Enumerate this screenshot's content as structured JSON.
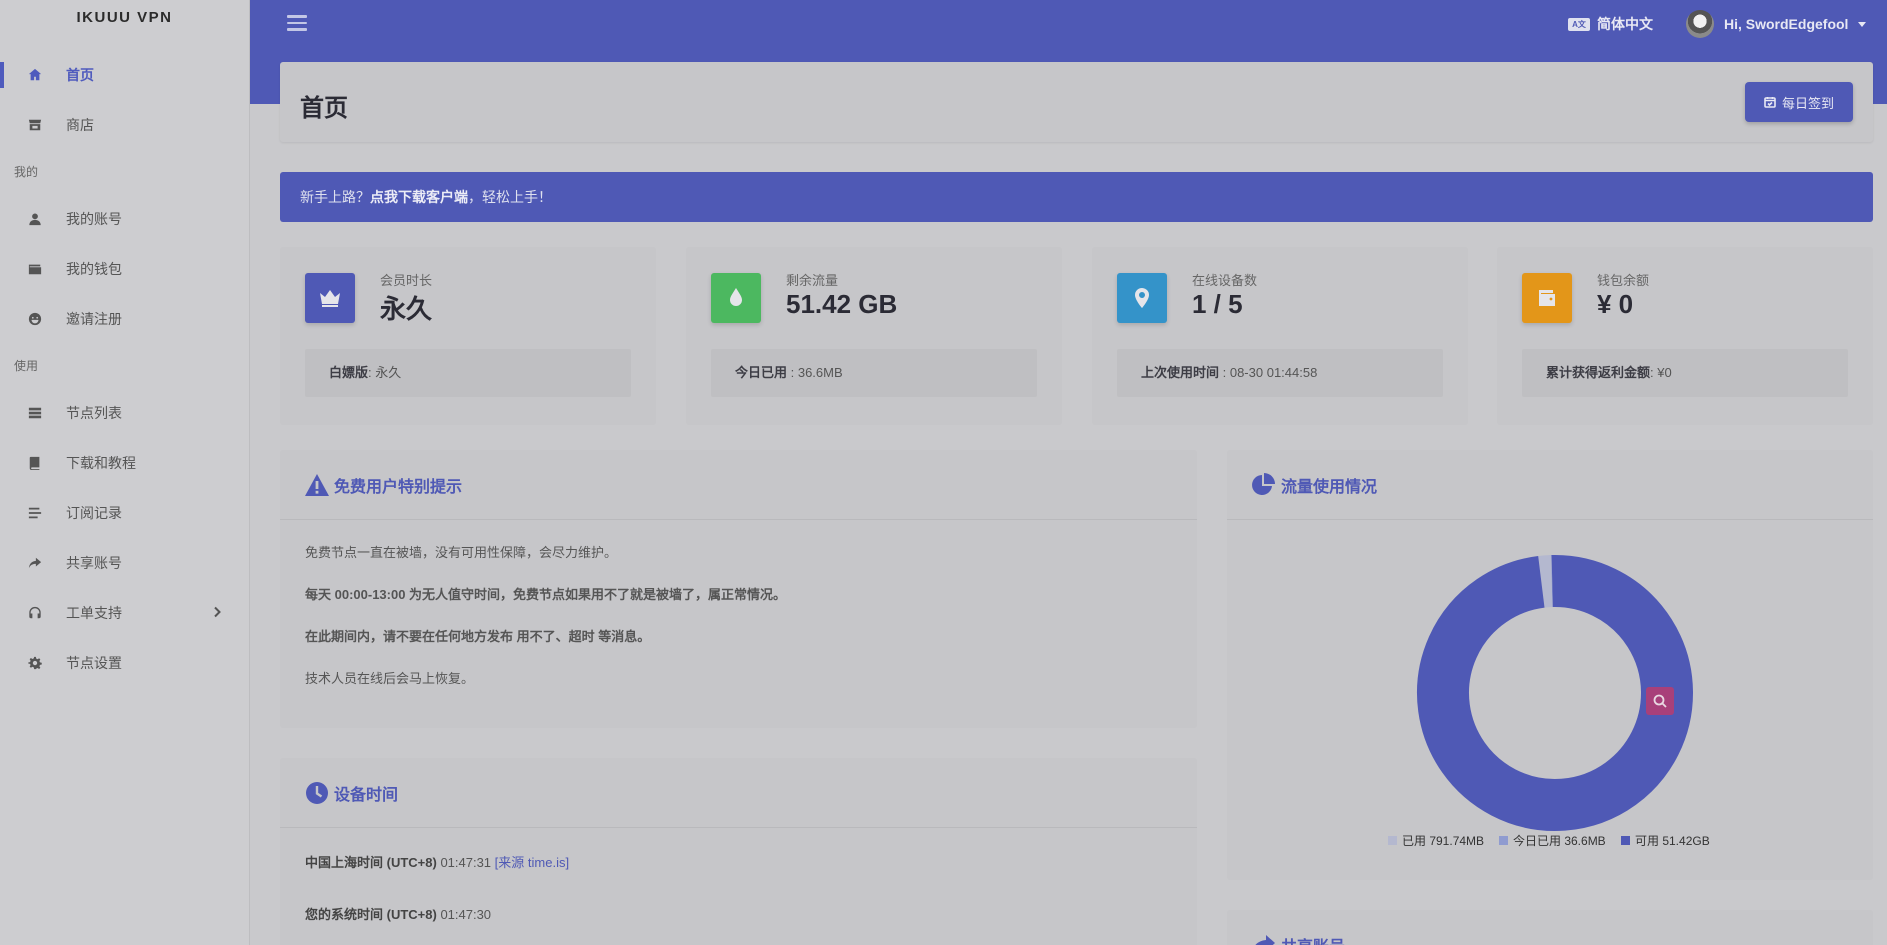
{
  "brand": "IKUUU VPN",
  "sidebar": {
    "items_top": [
      {
        "label": "首页",
        "icon": "home-icon",
        "active": true
      },
      {
        "label": "商店",
        "icon": "store-icon",
        "active": false
      }
    ],
    "section_mine": "我的",
    "items_mine": [
      {
        "label": "我的账号",
        "icon": "user-icon"
      },
      {
        "label": "我的钱包",
        "icon": "wallet-icon"
      },
      {
        "label": "邀请注册",
        "icon": "smile-icon"
      }
    ],
    "section_use": "使用",
    "items_use": [
      {
        "label": "节点列表",
        "icon": "server-icon"
      },
      {
        "label": "下载和教程",
        "icon": "book-icon"
      },
      {
        "label": "订阅记录",
        "icon": "list-icon"
      },
      {
        "label": "共享账号",
        "icon": "share-icon"
      },
      {
        "label": "工单支持",
        "icon": "headset-icon"
      },
      {
        "label": "节点设置",
        "icon": "gear-icon"
      }
    ]
  },
  "header": {
    "language": "简体中文",
    "language_icon_text": "A文",
    "user_greeting": "Hi, SwordEdgefool"
  },
  "page": {
    "title": "首页",
    "checkin_label": "每日签到"
  },
  "announcement": {
    "prefix": "新手上路？",
    "link": "点我下载客户端",
    "suffix": "，轻松上手！"
  },
  "stats": [
    {
      "label": "会员时长",
      "value": "永久",
      "foot_key": "白嫖版",
      "foot_val": ": 永久",
      "color": "#4f59b5",
      "icon": "crown-icon"
    },
    {
      "label": "剩余流量",
      "value": "51.42 GB",
      "foot_key": "今日已用",
      "foot_val": " : 36.6MB",
      "color": "#4cb860",
      "icon": "drop-icon"
    },
    {
      "label": "在线设备数",
      "value": "1 / 5",
      "foot_key": "上次使用时间",
      "foot_val": " : 08-30 01:44:58",
      "color": "#3493c9",
      "icon": "map-pin-icon"
    },
    {
      "label": "钱包余额",
      "value": "¥ 0",
      "foot_key": "累计获得返利金额",
      "foot_val": ": ¥0",
      "color": "#e39619",
      "icon": "wallet-icon"
    }
  ],
  "notice": {
    "title": "免费用户特别提示",
    "line1": "免费节点一直在被墙，没有可用性保障，会尽力维护。",
    "line2": "每天 00:00-13:00 为无人值守时间，免费节点如果用不了就是被墙了，属正常情况。",
    "line3": "在此期间内，请不要在任何地方发布 用不了、超时 等消息。",
    "line4": "技术人员在线后会马上恢复。"
  },
  "device_time": {
    "title": "设备时间",
    "shanghai_label": "中国上海时间 (UTC+8)",
    "shanghai_time": "01:47:31",
    "source_link": "[来源 time.is]",
    "system_label": "您的系统时间 (UTC+8)",
    "system_time": "01:47:30"
  },
  "traffic": {
    "title": "流量使用情况",
    "legend": [
      {
        "label": "已用 791.74MB",
        "color": "#b4b8cf"
      },
      {
        "label": "今日已用 36.6MB",
        "color": "#8f9bd0"
      },
      {
        "label": "可用 51.42GB",
        "color": "#4f59b5"
      }
    ]
  },
  "chart_data": {
    "type": "pie",
    "labels": [
      "已用",
      "今日已用",
      "可用"
    ],
    "values_mb": [
      791.74,
      36.6,
      52654.08
    ],
    "colors": [
      "#b4b8cf",
      "#8f9bd0",
      "#4f59b5"
    ]
  },
  "shared_panel_title": "共享账号"
}
